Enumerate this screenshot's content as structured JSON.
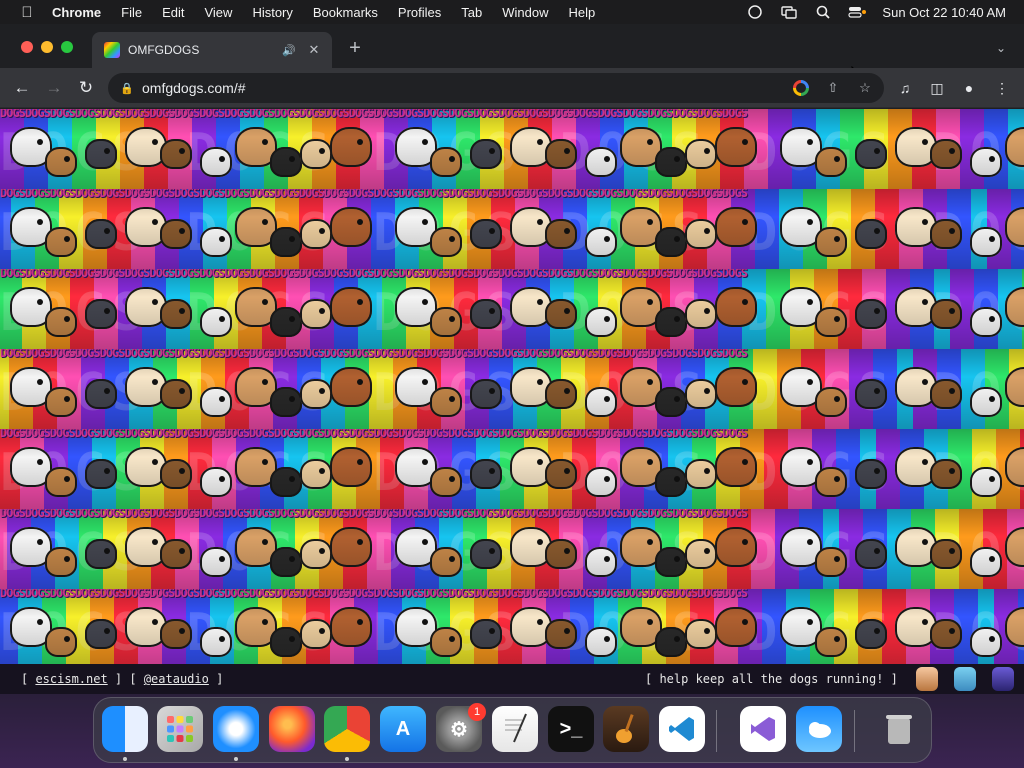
{
  "menubar": {
    "app_name": "Chrome",
    "items": [
      "File",
      "Edit",
      "View",
      "History",
      "Bookmarks",
      "Profiles",
      "Tab",
      "Window",
      "Help"
    ],
    "clock": "Sun Oct 22  10:40 AM"
  },
  "browser": {
    "tab_title": "OMFGDOGS",
    "url": "omfgdogs.com/#"
  },
  "page": {
    "repeating_text": "DOGSDOGSDOGSDOGSDOGSDOGSDOGSDOGSDOGSDOGSDOGSDOGSDOGSDOGSDOGSDOGSDOGSDOGSDOGSDOGSDOGSDOGSDOGSDOGSDOGSDOGSDOGSDOGSDOGSDOGS",
    "background_letters": "DOGS DOGS DOGS DOGS DOGS DOGS DOGS DOGS"
  },
  "footer": {
    "left_open": "[ ",
    "link1": "escism.net",
    "mid": " ] [ ",
    "link2": "@eataudio",
    "left_close": " ]",
    "right": "[ help keep all the dogs running! ]"
  },
  "dock": {
    "apps": [
      "Finder",
      "Launchpad",
      "Safari",
      "Firefox",
      "Chrome",
      "App Store",
      "System Settings",
      "TextEdit",
      "Terminal",
      "GarageBand",
      "Visual Studio Code",
      "Visual Studio",
      "Weather",
      "Trash"
    ],
    "settings_badge": "1"
  },
  "colors": {
    "accent": "#ff3fb0",
    "rainbow": [
      "#8a2be2",
      "#3355ff",
      "#16c4f0",
      "#2ee86a",
      "#f7f02a",
      "#ff9b1c",
      "#ff2a3d",
      "#ff4fb3"
    ]
  }
}
